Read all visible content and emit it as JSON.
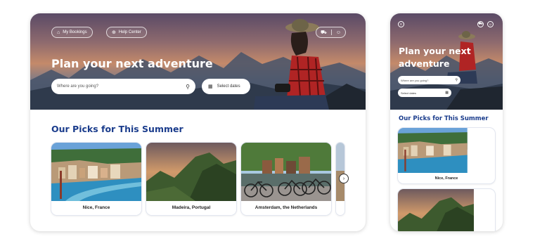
{
  "desktop": {
    "nav": {
      "bookings_label": "My Bookings",
      "bookings_icon": "suitcase-icon",
      "help_label": "Help Center",
      "help_icon": "globe-icon",
      "cart_icon": "cart-icon",
      "account_icon": "user-icon"
    },
    "hero": {
      "title": "Plan your next adventure"
    },
    "search": {
      "placeholder": "Where are you going?",
      "icon": "search-icon"
    },
    "dates": {
      "label": "Select dates",
      "icon": "calendar-icon"
    },
    "section_title": "Our Picks for This Summer",
    "cards": [
      {
        "caption": "Nice, France"
      },
      {
        "caption": "Madeira, Portugal"
      },
      {
        "caption": "Amsterdam, the Netherlands"
      }
    ],
    "next_icon": "chevron-right-icon"
  },
  "mobile": {
    "menu_icon": "menu-icon",
    "cart_icon": "cart-icon",
    "account_icon": "user-icon",
    "hero": {
      "title": "Plan your next adventure"
    },
    "search": {
      "placeholder": "Where are you going?"
    },
    "dates": {
      "label": "Select dates"
    },
    "section_title": "Our Picks for This Summer",
    "cards": [
      {
        "caption": "Nice, France"
      },
      {
        "caption": ""
      }
    ]
  },
  "colors": {
    "accent": "#1a3c8c",
    "hero_sunset": "#c48a6a"
  }
}
